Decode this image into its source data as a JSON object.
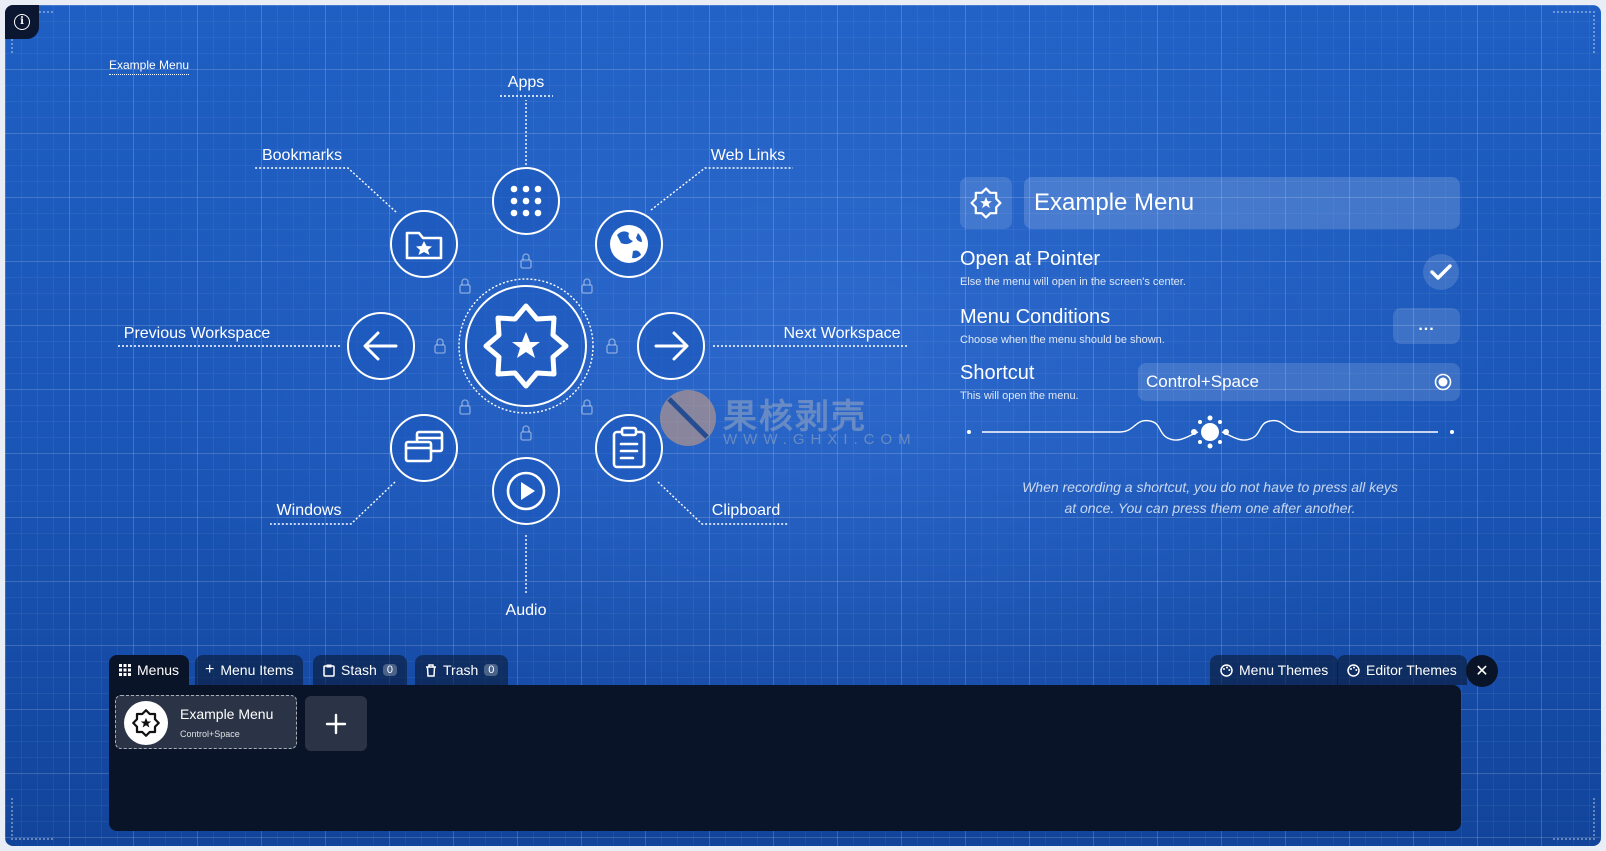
{
  "menu": {
    "title": "Example Menu",
    "items": [
      {
        "id": "apps",
        "label": "Apps",
        "icon": "apps-grid-icon"
      },
      {
        "id": "web-links",
        "label": "Web Links",
        "icon": "globe-icon"
      },
      {
        "id": "next-workspace",
        "label": "Next Workspace",
        "icon": "arrow-right-icon"
      },
      {
        "id": "clipboard",
        "label": "Clipboard",
        "icon": "clipboard-icon"
      },
      {
        "id": "audio",
        "label": "Audio",
        "icon": "play-icon"
      },
      {
        "id": "windows",
        "label": "Windows",
        "icon": "windows-icon"
      },
      {
        "id": "previous-workspace",
        "label": "Previous Workspace",
        "icon": "arrow-left-icon"
      },
      {
        "id": "bookmarks",
        "label": "Bookmarks",
        "icon": "folder-star-icon"
      }
    ],
    "center_icon": "star-badge-icon"
  },
  "panel": {
    "name_value": "Example Menu",
    "open_at_pointer": {
      "title": "Open at Pointer",
      "desc": "Else the menu will open in the screen's center.",
      "checked": true
    },
    "conditions": {
      "title": "Menu Conditions",
      "desc": "Choose when the menu should be shown.",
      "button": "..."
    },
    "shortcut": {
      "title": "Shortcut",
      "desc": "This will open the menu.",
      "value": "Control+Space"
    },
    "hint_line1": "When recording a shortcut, you do not have to press all keys",
    "hint_line2": "at once. You can press them one after another."
  },
  "watermark": {
    "text": "果核剥壳",
    "url": "WWW.GHXI.COM"
  },
  "tabs": {
    "menus": "Menus",
    "menu_items": "Menu Items",
    "stash": "Stash",
    "stash_count": "0",
    "trash": "Trash",
    "trash_count": "0",
    "menu_themes": "Menu Themes",
    "editor_themes": "Editor Themes"
  },
  "tray": {
    "card_name": "Example Menu",
    "card_shortcut": "Control+Space"
  },
  "colors": {
    "background": "#1f5fc3",
    "tray": "#0a1428"
  }
}
